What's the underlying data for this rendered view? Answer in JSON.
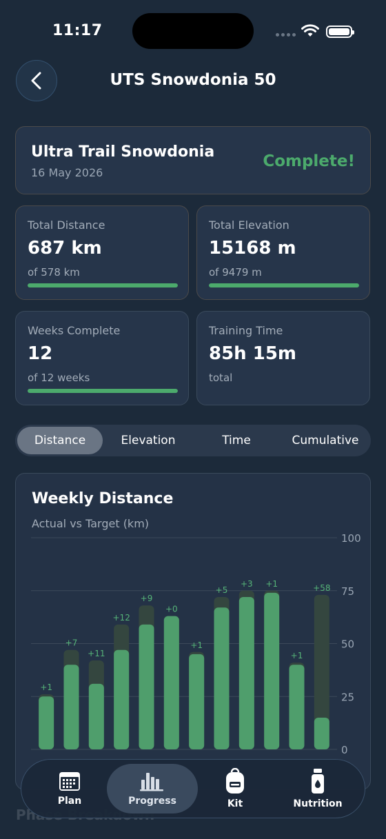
{
  "status": {
    "time": "11:17"
  },
  "nav": {
    "title": "UTS Snowdonia 50"
  },
  "race": {
    "name": "Ultra Trail Snowdonia",
    "date": "16 May 2026",
    "status": "Complete!",
    "status_color": "#4caa6c"
  },
  "stats": [
    {
      "label": "Total Distance",
      "value": "687 km",
      "sub": "of 578 km",
      "progress": 1.0
    },
    {
      "label": "Total Elevation",
      "value": "15168 m",
      "sub": "of 9479 m",
      "progress": 1.0
    },
    {
      "label": "Weeks Complete",
      "value": "12",
      "sub": "of 12 weeks",
      "progress": 1.0
    },
    {
      "label": "Training Time",
      "value": "85h 15m",
      "sub": "total"
    }
  ],
  "segments": {
    "items": [
      "Distance",
      "Elevation",
      "Time",
      "Cumulative"
    ],
    "selected": "Distance"
  },
  "chart": {
    "title": "Weekly Distance",
    "subtitle": "Actual vs Target (km)"
  },
  "chart_data": {
    "type": "bar",
    "title": "Weekly Distance",
    "subtitle": "Actual vs Target (km)",
    "ylim": [
      0,
      100
    ],
    "yticks": [
      0,
      25,
      50,
      75,
      100
    ],
    "grid": true,
    "y_axis_side": "right",
    "series": [
      {
        "values": [
          25,
          40,
          31,
          47,
          59,
          63,
          45,
          67,
          72,
          74,
          40,
          15
        ]
      },
      {
        "values": [
          26,
          47,
          42,
          59,
          68,
          63,
          46,
          72,
          75,
          75,
          41,
          73
        ]
      }
    ],
    "labels": [
      "+1",
      "+7",
      "+11",
      "+12",
      "+9",
      "+0",
      "+1",
      "+5",
      "+3",
      "+1",
      "+1",
      "+58"
    ],
    "colors": {
      "actual": "#4f9e6c",
      "target": "#34463f",
      "label": "#56b478",
      "grid": "#3d4a5a"
    }
  },
  "tabs": [
    {
      "label": "Plan",
      "icon": "calendar-icon"
    },
    {
      "label": "Progress",
      "icon": "bar-chart-icon",
      "active": true
    },
    {
      "label": "Kit",
      "icon": "backpack-icon"
    },
    {
      "label": "Nutrition",
      "icon": "bottle-icon"
    }
  ],
  "behind_text": "Phase Breakdown"
}
